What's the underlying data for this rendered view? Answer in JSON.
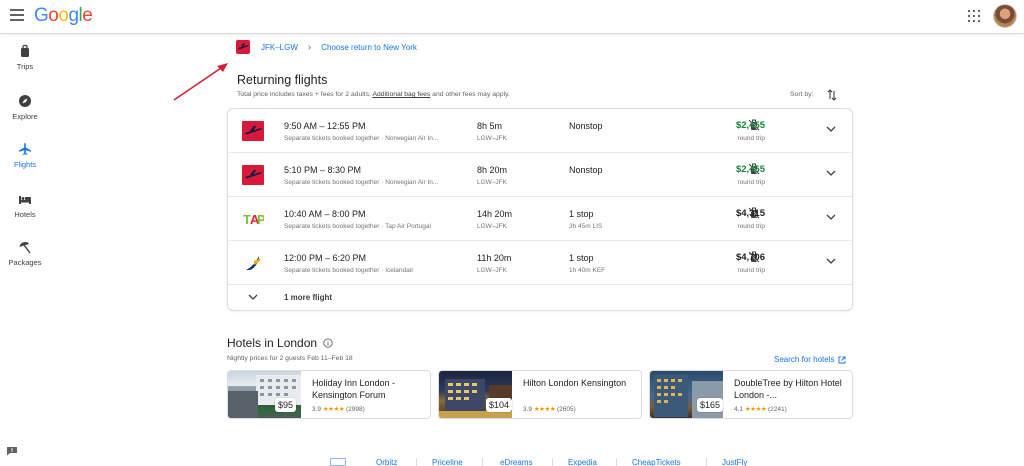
{
  "header": {
    "logo": "Google"
  },
  "nav": {
    "items": [
      {
        "label": "Trips"
      },
      {
        "label": "Explore"
      },
      {
        "label": "Flights"
      },
      {
        "label": "Hotels"
      },
      {
        "label": "Packages"
      }
    ]
  },
  "breadcrumb": {
    "route": "JFK–LGW",
    "return_link": "Choose return to New York"
  },
  "results": {
    "title": "Returning flights",
    "subtitle_pre": "Total price includes taxes + fees for 2 adults. ",
    "subtitle_link": "Additional bag fees",
    "subtitle_post": " and other fees may apply.",
    "sort_label": "Sort by:"
  },
  "flights": [
    {
      "times": "9:50 AM – 12:55 PM",
      "note": "Separate tickets booked together",
      "airline": "Norwegian Air In...",
      "duration": "8h 5m",
      "airports": "LGW–JFK",
      "stops": "Nonstop",
      "stop_detail": "",
      "price": "$2,455",
      "price_type": "round trip"
    },
    {
      "times": "5:10 PM – 8:30 PM",
      "note": "Separate tickets booked together",
      "airline": "Norwegian Air In...",
      "duration": "8h 20m",
      "airports": "LGW–JFK",
      "stops": "Nonstop",
      "stop_detail": "",
      "price": "$2,455",
      "price_type": "round trip"
    },
    {
      "times": "10:40 AM – 8:00 PM",
      "note": "Separate tickets booked together",
      "airline": "Tap Air Portugal",
      "duration": "14h 20m",
      "airports": "LGW–JFK",
      "stops": "1 stop",
      "stop_detail": "3h 45m LIS",
      "price": "$4,315",
      "price_type": "round trip"
    },
    {
      "times": "12:00 PM – 6:20 PM",
      "note": "Separate tickets booked together",
      "airline": "Icelandair",
      "duration": "11h 20m",
      "airports": "LGW–JFK",
      "stops": "1 stop",
      "stop_detail": "1h 40m KEF",
      "price": "$4,706",
      "price_type": "round trip"
    }
  ],
  "more_flights": "1 more flight",
  "hotels": {
    "title": "Hotels in London",
    "subtitle": "Nightly prices for 2 guests Feb 11–Feb 18",
    "search_link": "Search for hotels",
    "items": [
      {
        "name": "Holiday Inn London - Kensington Forum",
        "price": "$95",
        "rating": "3.9",
        "stars": "★★★★",
        "reviews": "(2998)"
      },
      {
        "name": "Hilton London Kensington",
        "price": "$104",
        "rating": "3.9",
        "stars": "★★★★",
        "reviews": "(2605)"
      },
      {
        "name": "DoubleTree by Hilton Hotel London -...",
        "price": "$165",
        "rating": "4.1",
        "stars": "★★★★",
        "reviews": "(2241)"
      }
    ]
  },
  "footer": {
    "links": [
      "Orbitz",
      "Priceline",
      "eDreams",
      "Expedia",
      "CheapTickets",
      "JustFly"
    ]
  },
  "colors": {
    "accent": "#1a73e8",
    "price_green": "#188038",
    "norwegian_red": "#d81939",
    "arrow_red": "#d3203a"
  }
}
